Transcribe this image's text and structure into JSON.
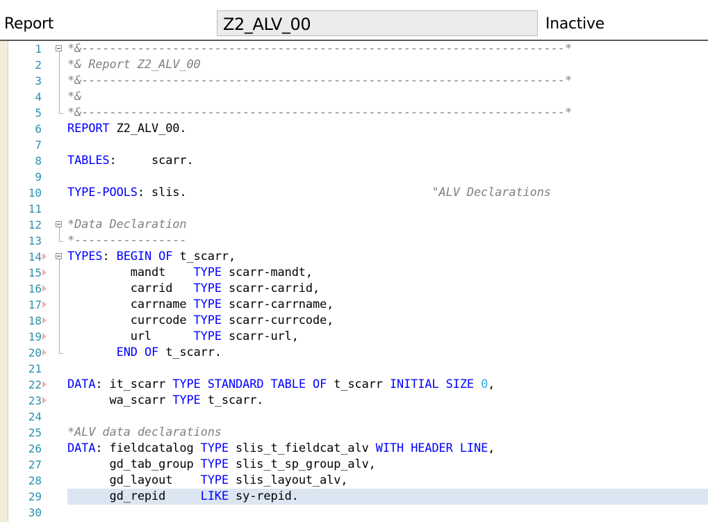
{
  "header": {
    "type_label": "Report",
    "program_name": "Z2_ALV_00",
    "status": "Inactive"
  },
  "editor": {
    "active_line": 29,
    "lines": [
      {
        "n": "1",
        "text": "*&---------------------------------------------------------------------*"
      },
      {
        "n": "2",
        "text": "*& Report Z2_ALV_00"
      },
      {
        "n": "3",
        "text": "*&---------------------------------------------------------------------*"
      },
      {
        "n": "4",
        "text": "*&"
      },
      {
        "n": "5",
        "text": "*&---------------------------------------------------------------------*"
      },
      {
        "n": "6",
        "text": "REPORT Z2_ALV_00."
      },
      {
        "n": "7",
        "text": ""
      },
      {
        "n": "8",
        "text": "TABLES:     scarr."
      },
      {
        "n": "9",
        "text": ""
      },
      {
        "n": "10",
        "text": "TYPE-POOLS: slis.                                   \"ALV Declarations"
      },
      {
        "n": "11",
        "text": ""
      },
      {
        "n": "12",
        "text": "*Data Declaration"
      },
      {
        "n": "13",
        "text": "*----------------"
      },
      {
        "n": "14",
        "text": "TYPES: BEGIN OF t_scarr,"
      },
      {
        "n": "15",
        "text": "         mandt    TYPE scarr-mandt,"
      },
      {
        "n": "16",
        "text": "         carrid   TYPE scarr-carrid,"
      },
      {
        "n": "17",
        "text": "         carrname TYPE scarr-carrname,"
      },
      {
        "n": "18",
        "text": "         currcode TYPE scarr-currcode,"
      },
      {
        "n": "19",
        "text": "         url      TYPE scarr-url,"
      },
      {
        "n": "20",
        "text": "       END OF t_scarr."
      },
      {
        "n": "21",
        "text": ""
      },
      {
        "n": "22",
        "text": "DATA: it_scarr TYPE STANDARD TABLE OF t_scarr INITIAL SIZE 0,"
      },
      {
        "n": "23",
        "text": "      wa_scarr TYPE t_scarr."
      },
      {
        "n": "24",
        "text": ""
      },
      {
        "n": "25",
        "text": "*ALV data declarations"
      },
      {
        "n": "26",
        "text": "DATA: fieldcatalog TYPE slis_t_fieldcat_alv WITH HEADER LINE,"
      },
      {
        "n": "27",
        "text": "      gd_tab_group TYPE slis_t_sp_group_alv,"
      },
      {
        "n": "28",
        "text": "      gd_layout    TYPE slis_layout_alv,"
      },
      {
        "n": "29",
        "text": "      gd_repid     LIKE sy-repid."
      },
      {
        "n": "30",
        "text": ""
      }
    ]
  },
  "colors": {
    "keyword": "#0000ff",
    "comment": "#808080",
    "number": "#3aa6e0",
    "line_number": "#2b91af",
    "active_line_bg": "#dce6f2",
    "bookmark_strip": "#f3ecda"
  }
}
